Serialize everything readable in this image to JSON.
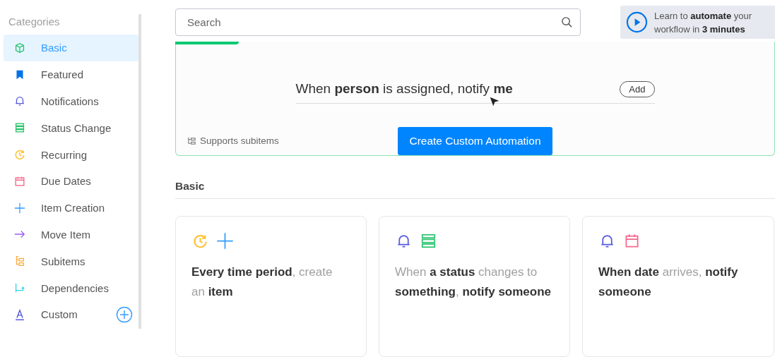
{
  "sidebar": {
    "title": "Categories",
    "items": [
      {
        "label": "Basic",
        "selected": true
      },
      {
        "label": "Featured",
        "selected": false
      },
      {
        "label": "Notifications",
        "selected": false
      },
      {
        "label": "Status Change",
        "selected": false
      },
      {
        "label": "Recurring",
        "selected": false
      },
      {
        "label": "Due Dates",
        "selected": false
      },
      {
        "label": "Item Creation",
        "selected": false
      },
      {
        "label": "Move Item",
        "selected": false
      },
      {
        "label": "Subitems",
        "selected": false
      },
      {
        "label": "Dependencies",
        "selected": false
      },
      {
        "label": "Custom",
        "selected": false
      }
    ]
  },
  "search": {
    "placeholder": "Search"
  },
  "promo": {
    "text": "Learn to **automate** your workflow in **3 minutes**"
  },
  "custom_card": {
    "sentence": "When **person** is assigned, notify **me**",
    "add_button": "Add",
    "create_button": "Create Custom Automation",
    "note": "Supports subitems"
  },
  "section": {
    "title": "Basic"
  },
  "recipes": [
    {
      "text": "**Every time period**, create an **item**"
    },
    {
      "text": "When **a status** changes to **something**, **notify someone**"
    },
    {
      "text": "**When date** arrives, **notify someone**"
    }
  ]
}
